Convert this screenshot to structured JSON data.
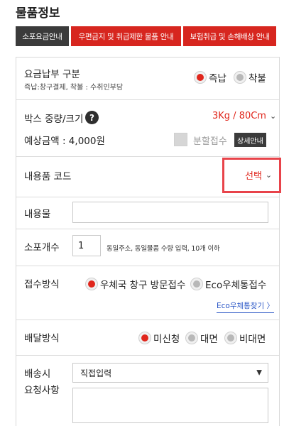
{
  "section_title": "물품정보",
  "tabs": [
    {
      "label": "소포요금안내"
    },
    {
      "label": "우편금지 및 취급제한 물품 안내"
    },
    {
      "label": "보험취급 및 손해배상 안내"
    }
  ],
  "payment": {
    "label": "요금납부 구분",
    "sub": "즉납:창구결제, 착불 : 수취인부담",
    "options": [
      "즉납",
      "착불"
    ],
    "selected": "즉납"
  },
  "box": {
    "label": "박스 중량/크기",
    "help_icon": "?",
    "value": "3Kg / 80Cm",
    "estimate_label": "예상금액 : 4,000원",
    "split_label": "분할접수",
    "detail_button": "상세안내"
  },
  "content_code": {
    "label": "내용품 코드",
    "value": "선택"
  },
  "contents": {
    "label": "내용물",
    "value": ""
  },
  "quantity": {
    "label": "소포개수",
    "value": "1",
    "hint": "동일주소, 동일물품 수량 입력, 10개 이하"
  },
  "reception": {
    "label": "접수방식",
    "options": [
      "우체국 창구 방문접수",
      "Eco우체통접수"
    ],
    "selected": "우체국 창구 방문접수",
    "link": "Eco우체통찾기 〉"
  },
  "delivery": {
    "label": "배달방식",
    "options": [
      "미신청",
      "대면",
      "비대면"
    ],
    "selected": "미신청"
  },
  "request": {
    "label_line1": "배송시",
    "label_line2": "요청사항",
    "select_value": "직접입력",
    "text_value": ""
  },
  "colors": {
    "accent_red": "#e0261c",
    "tab_dark": "#3b3b3b",
    "tab_red": "#d7261f",
    "highlight_box": "#e8434a",
    "link_blue": "#2a56c6"
  }
}
